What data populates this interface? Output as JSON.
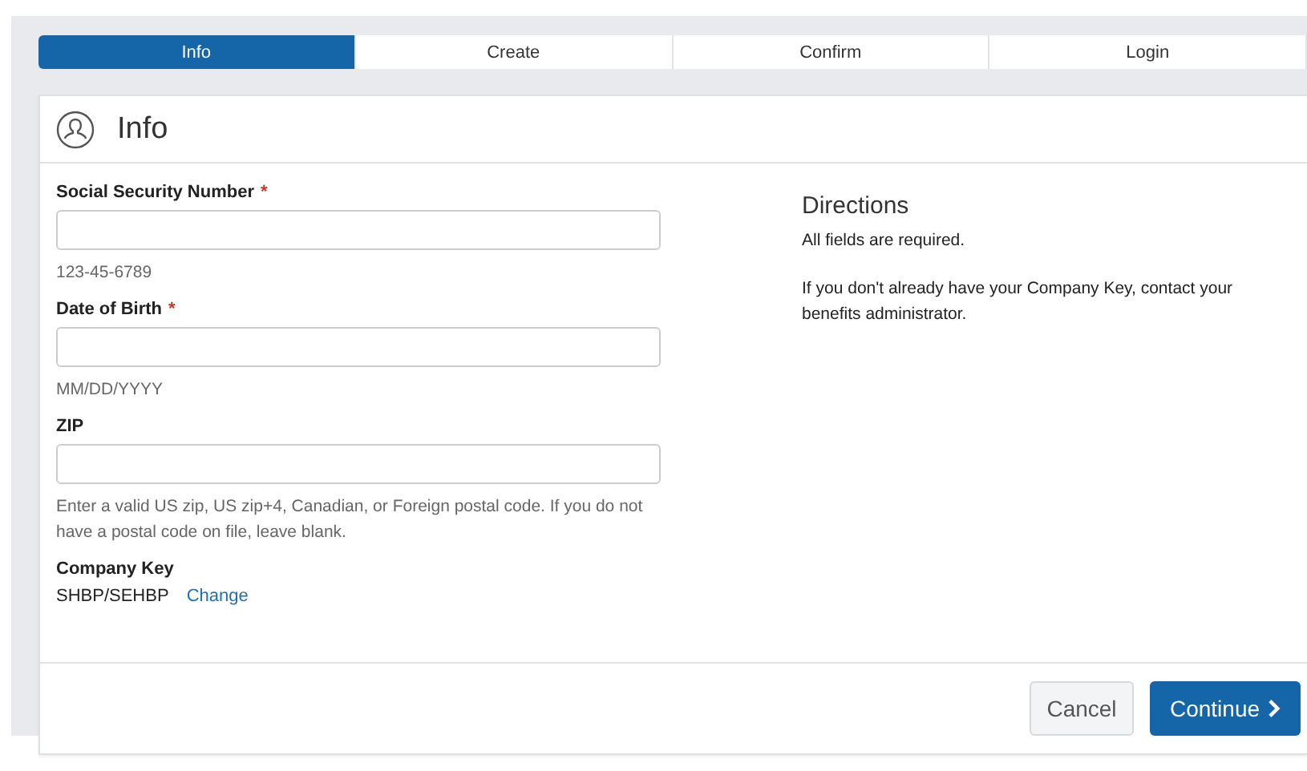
{
  "steps": [
    {
      "label": "Info",
      "selected": true
    },
    {
      "label": "Create",
      "selected": false
    },
    {
      "label": "Confirm",
      "selected": false
    },
    {
      "label": "Login",
      "selected": false
    }
  ],
  "card": {
    "title": "Info"
  },
  "fields": [
    {
      "label": "Social Security Number",
      "required_mark": "*",
      "hint": "123-45-6789"
    },
    {
      "label": "Date of Birth",
      "required_mark": "*",
      "hint": "MM/DD/YYYY"
    },
    {
      "label": "ZIP",
      "hint": "Enter a valid US zip, US zip+4, Canadian, or Foreign postal code. If you do not have a postal code on file, leave blank."
    }
  ],
  "company_key": {
    "label": "Company Key",
    "value": "SHBP/SEHBP",
    "link": "Change"
  },
  "directions": {
    "title": "Directions",
    "paragraphs": [
      "All fields are required.",
      "If you don't already have your Company Key, contact your benefits administrator."
    ]
  },
  "buttons": {
    "cancel": "Cancel",
    "continue": "Continue"
  }
}
